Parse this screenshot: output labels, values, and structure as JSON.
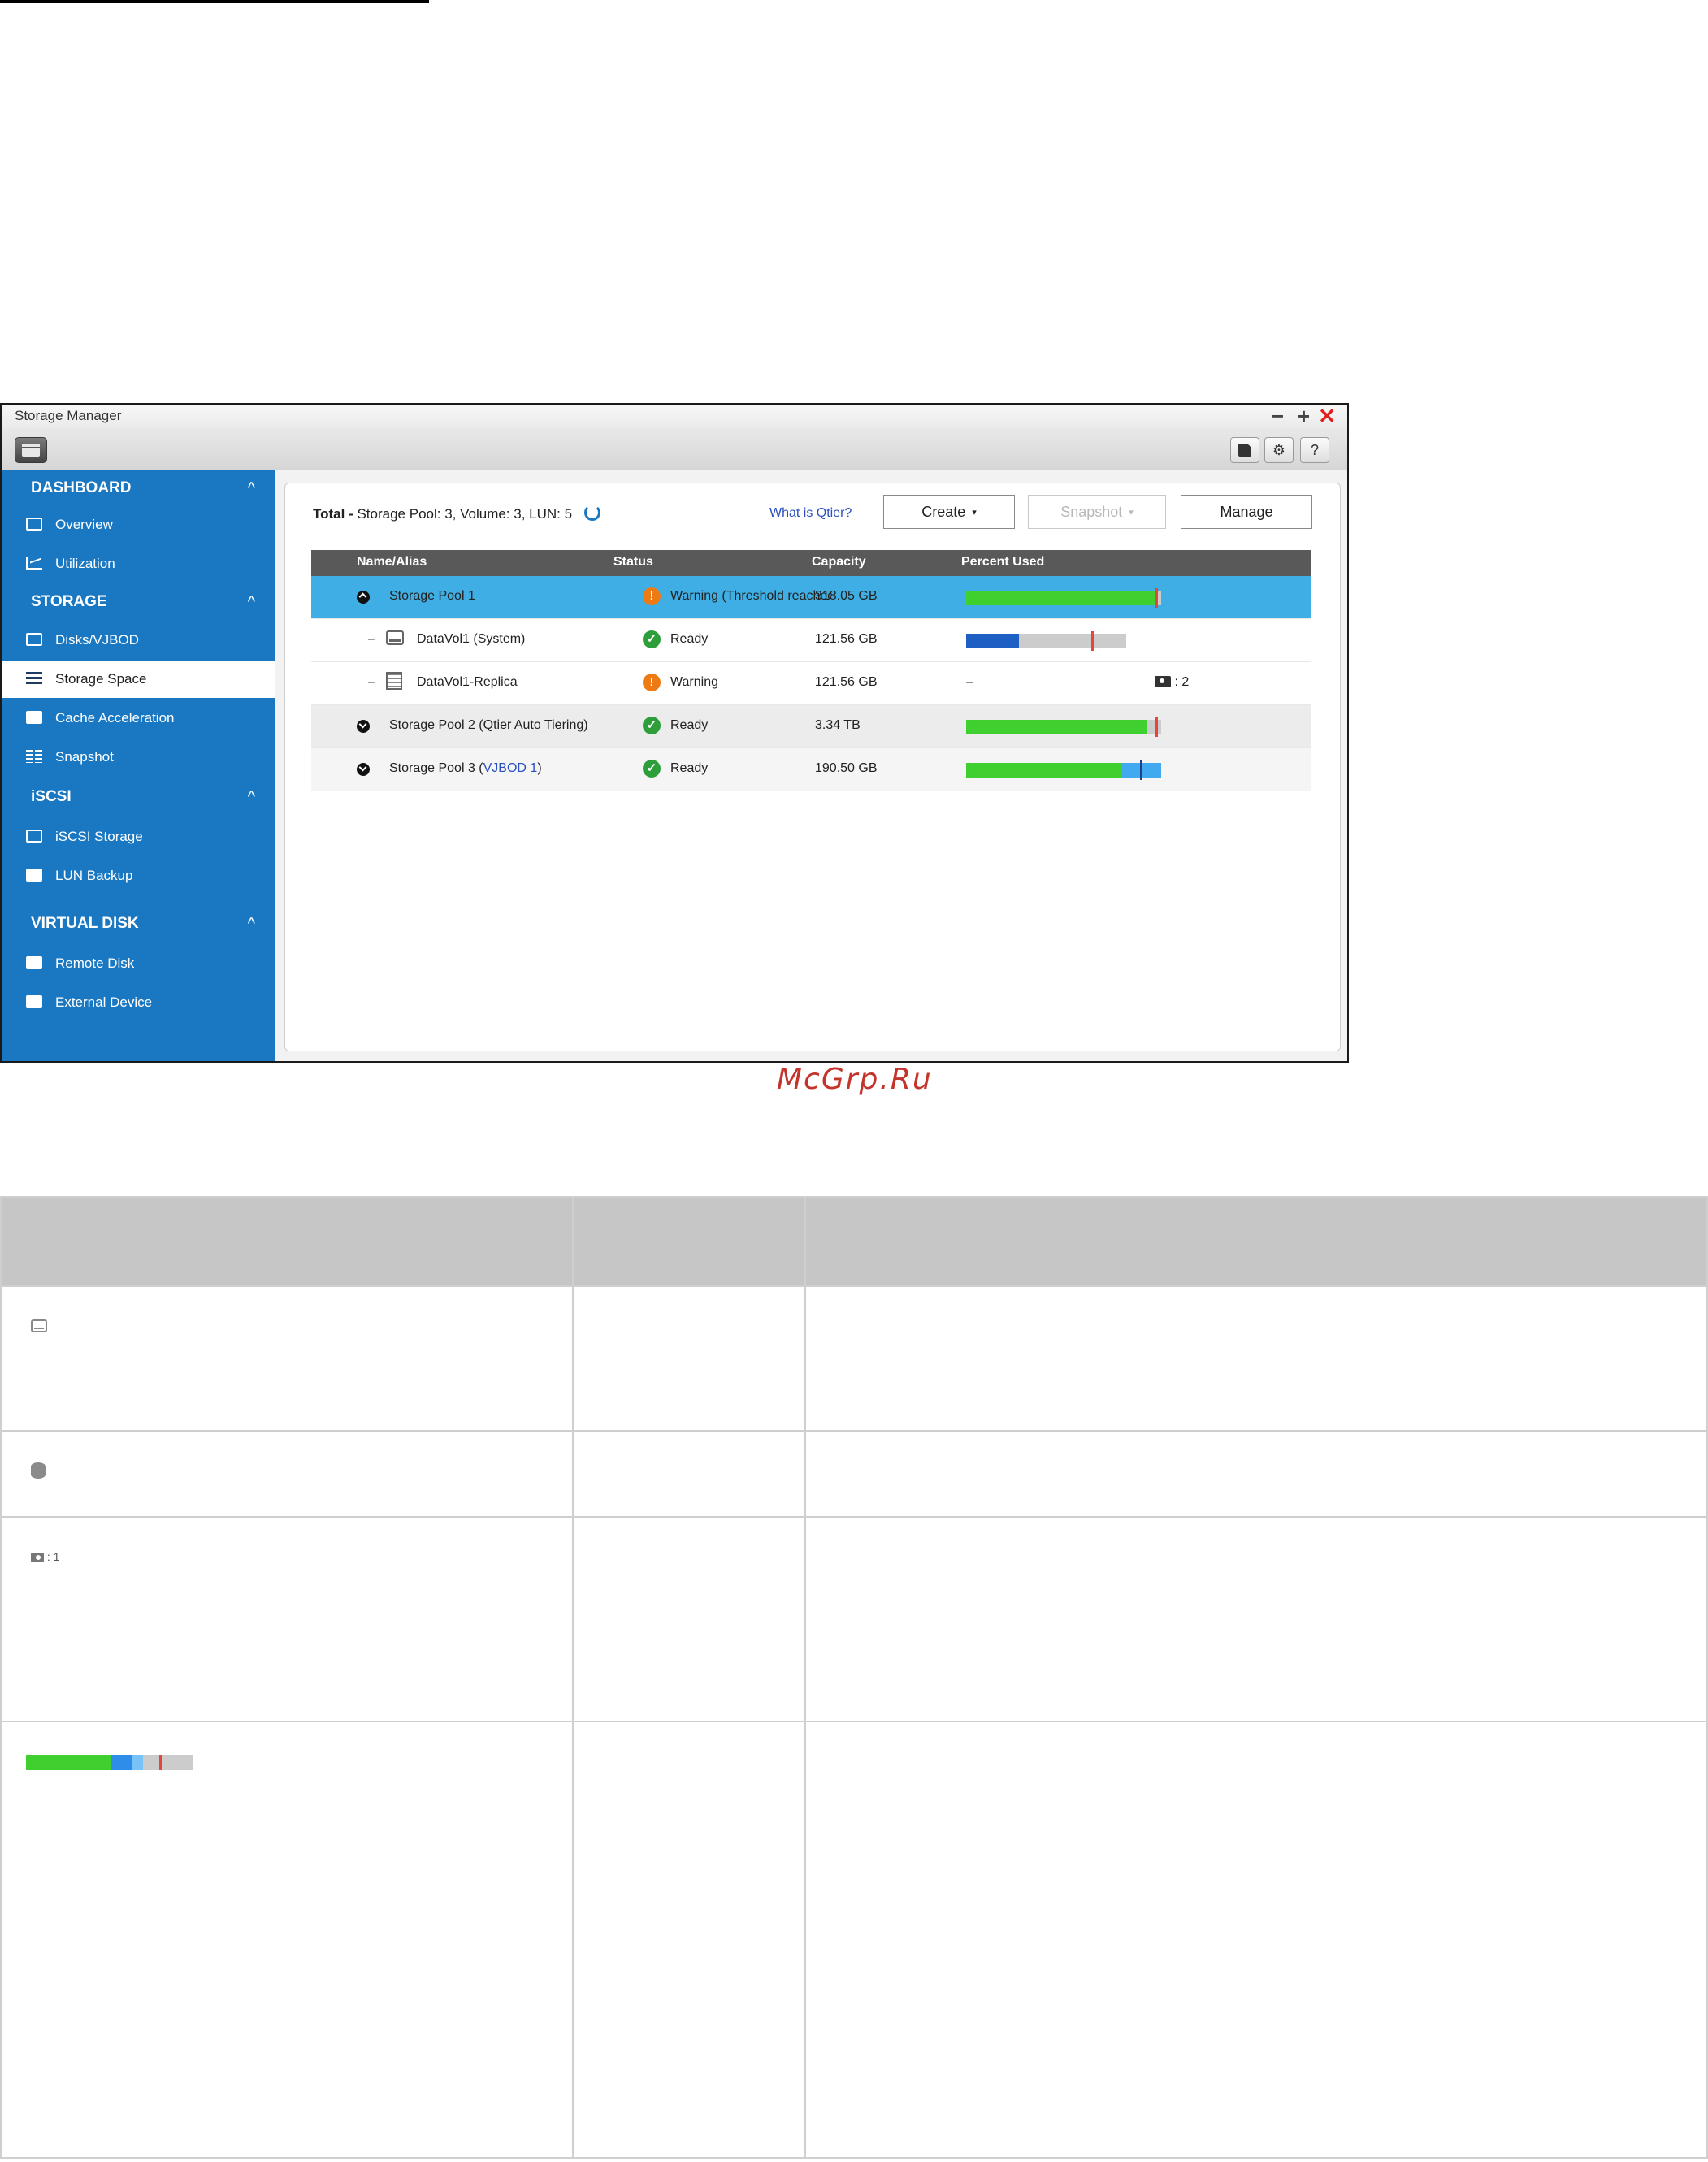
{
  "window": {
    "title": "Storage Manager",
    "controls": {
      "minimize": "−",
      "maximize": "+",
      "close": "✕"
    },
    "toolbar_help": "?"
  },
  "sidebar": {
    "sections": [
      {
        "label": "DASHBOARD",
        "items": [
          "Overview",
          "Utilization"
        ]
      },
      {
        "label": "STORAGE",
        "items": [
          "Disks/VJBOD",
          "Storage Space",
          "Cache Acceleration",
          "Snapshot"
        ]
      },
      {
        "label": "iSCSI",
        "items": [
          "iSCSI Storage",
          "LUN Backup"
        ]
      },
      {
        "label": "VIRTUAL DISK",
        "items": [
          "Remote Disk",
          "External Device"
        ]
      }
    ],
    "chevron": "^",
    "active_item": "Storage Space"
  },
  "main": {
    "summary_label": "Total -",
    "summary_value": "Storage Pool: 3, Volume: 3, LUN: 5",
    "qtier_link": "What is Qtier?",
    "buttons": {
      "create": "Create",
      "snapshot": "Snapshot",
      "manage": "Manage",
      "caret": "▾"
    },
    "columns": [
      "Name/Alias",
      "Status",
      "Capacity",
      "Percent Used"
    ],
    "rows": [
      {
        "name": "Storage Pool 1",
        "status": "Warning (Threshold reached)",
        "status_icon": "warning-icon",
        "capacity": "318.05 GB",
        "percent_used": {
          "used": 0.97,
          "threshold": 0.97,
          "color": "#3fcf2f"
        }
      },
      {
        "name": "DataVol1 (System)",
        "status": "Ready",
        "status_icon": "ready-icon",
        "capacity": "121.56 GB",
        "percent_used": {
          "used": 0.33,
          "threshold": 0.78,
          "color": "#1e5fc4"
        }
      },
      {
        "name": "DataVol1-Replica",
        "status": "Warning",
        "status_icon": "warning-icon",
        "capacity": "121.56 GB",
        "percent_used_text": "–",
        "snapshot_sep": ": ",
        "snapshot_count": "2"
      },
      {
        "name": "Storage Pool 2 (Qtier Auto Tiering)",
        "status": "Ready",
        "status_icon": "ready-icon",
        "capacity": "3.34 TB",
        "percent_used": {
          "used": 0.93,
          "threshold": 0.97,
          "color": "#3fcf2f"
        }
      },
      {
        "name_prefix": "Storage Pool 3 (",
        "name_link": "VJBOD 1",
        "name_suffix": ")",
        "status": "Ready",
        "status_icon": "ready-icon",
        "capacity": "190.50 GB",
        "percent_used": {
          "used": 0.8,
          "extra": 0.2,
          "threshold": 0.89,
          "color": "#3fcf2f",
          "extra_color": "#41a9f0"
        }
      }
    ]
  },
  "watermark": "McGrp.Ru",
  "reference_table": {
    "rows": [
      {
        "icon": "volume-icon"
      },
      {
        "icon": "database-icon"
      },
      {
        "icon": "snapshot-icon",
        "label": ": 1"
      },
      {
        "icon": "percent-used-bar"
      }
    ]
  },
  "colors": {
    "sidebar": "#1a78c2",
    "selected_row": "#3eaee4",
    "used": "#3fcf2f",
    "threshold": "#e1473b"
  }
}
